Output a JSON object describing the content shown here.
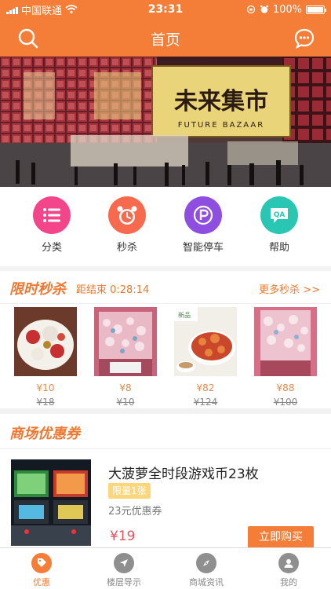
{
  "status_bar": {
    "carrier": "中国联通",
    "time": "23:31",
    "battery": "100%"
  },
  "header": {
    "title": "首页"
  },
  "banner": {
    "sign_main": "未来集市",
    "sign_sub": "FUTURE BAZAAR"
  },
  "quick_nav": [
    {
      "label": "分类",
      "icon": "list-icon",
      "color": "#f5458a"
    },
    {
      "label": "秒杀",
      "icon": "alarm-clock-icon",
      "color": "#f86a4e"
    },
    {
      "label": "智能停车",
      "icon": "parking-icon",
      "color": "#8e4fe0"
    },
    {
      "label": "帮助",
      "icon": "qa-icon",
      "color": "#29c7b3"
    }
  ],
  "flash_sale": {
    "title": "限时秒杀",
    "countdown": "距结束 0:28:14",
    "more": "更多秒杀 >>",
    "items": [
      {
        "price": "¥10",
        "original": "¥18"
      },
      {
        "price": "¥8",
        "original": "¥10"
      },
      {
        "price": "¥82",
        "original": "¥124"
      },
      {
        "price": "¥88",
        "original": "¥100"
      }
    ]
  },
  "coupons": {
    "title": "商场优惠券",
    "item": {
      "name": "大菠萝全时段游戏币23枚",
      "limit": "限量1张",
      "desc": "23元优惠券",
      "price": "¥19",
      "buy": "立即购买"
    }
  },
  "tab_bar": [
    {
      "label": "优惠",
      "active": true
    },
    {
      "label": "楼层导示",
      "active": false
    },
    {
      "label": "商城资讯",
      "active": false
    },
    {
      "label": "我的",
      "active": false
    }
  ],
  "colors": {
    "brand": "#f47d38",
    "accent": "#f0772f",
    "price": "#e8505b"
  }
}
